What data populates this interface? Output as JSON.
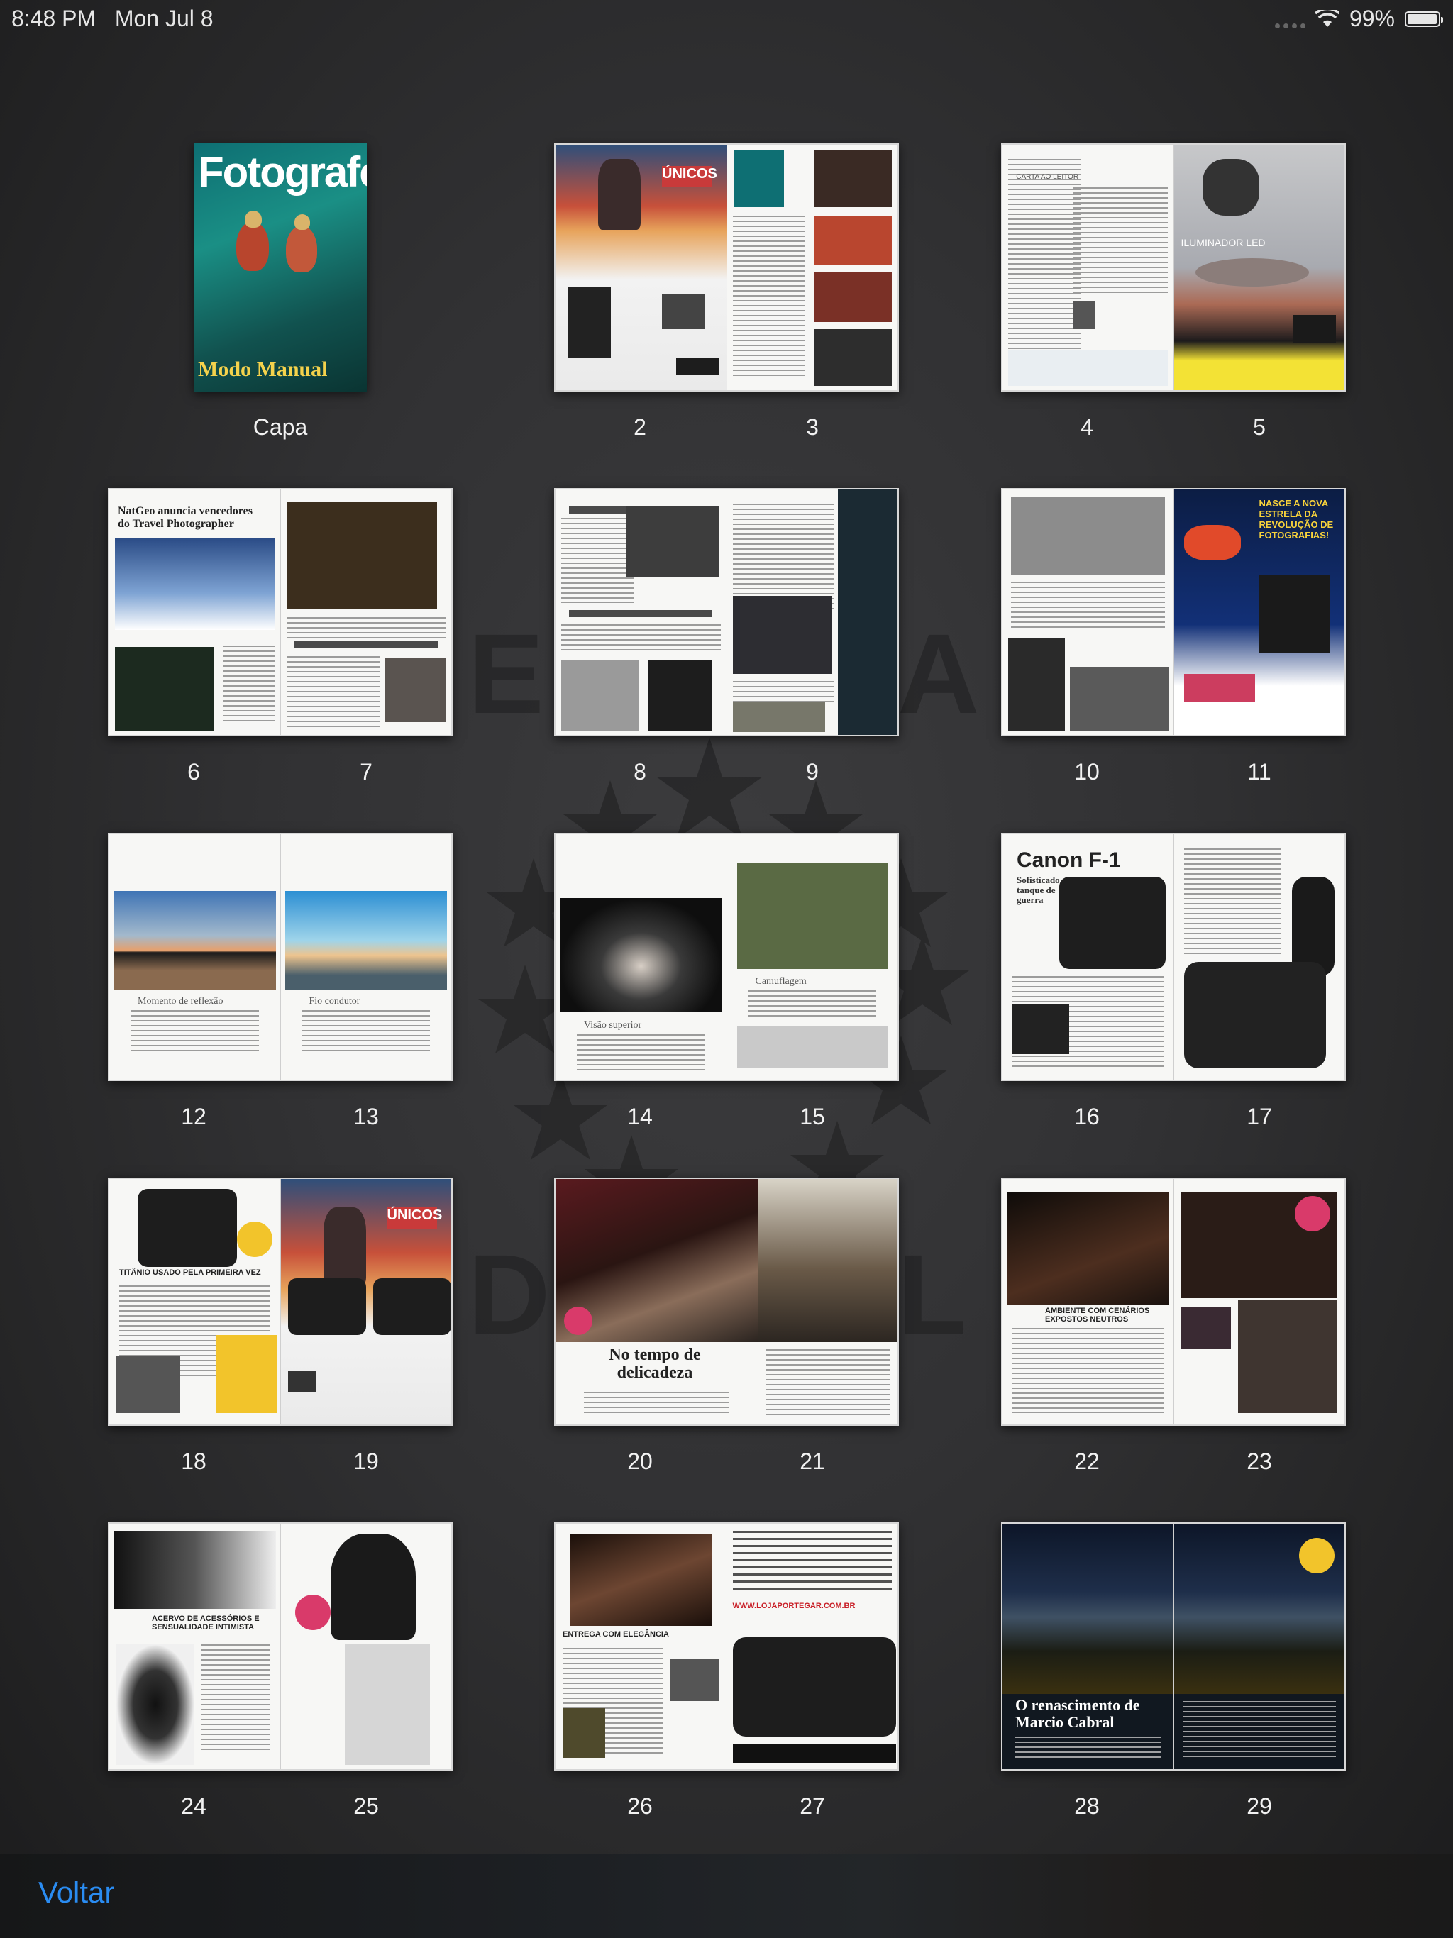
{
  "status_bar": {
    "time": "8:48 PM",
    "date": "Mon Jul 8",
    "wifi_icon": "wifi-icon",
    "battery_percent": "99%",
    "battery_level": 0.99
  },
  "cover": {
    "title": "Fotografe",
    "subtitle": "Modo Manual",
    "label": "Capa"
  },
  "spreads": [
    {
      "left": "2",
      "right": "3",
      "headline_left": "ÚNICOS"
    },
    {
      "left": "4",
      "right": "5",
      "headline_left": "CARTA AO LEITOR",
      "headline_right": "ILUMINADOR LED"
    },
    {
      "left": "6",
      "right": "7",
      "headline_left": "NatGeo anuncia vencedores do Travel Photographer"
    },
    {
      "left": "8",
      "right": "9"
    },
    {
      "left": "10",
      "right": "11",
      "headline_right": "NASCE A NOVA ESTRELA DA REVOLUÇÃO DE FOTOGRAFIAS!"
    },
    {
      "left": "12",
      "right": "13",
      "caption_left": "Momento de reflexão",
      "caption_right": "Fio condutor"
    },
    {
      "left": "14",
      "right": "15",
      "caption_left": "Visão superior",
      "caption_right": "Camuflagem"
    },
    {
      "left": "16",
      "right": "17",
      "headline_left": "Canon F-1",
      "subhead_left": "Sofisticado tanque de guerra"
    },
    {
      "left": "18",
      "right": "19",
      "headline_left": "TITÂNIO USADO PELA PRIMEIRA VEZ",
      "headline_right": "ÚNICOS"
    },
    {
      "left": "20",
      "right": "21",
      "headline_left": "No tempo de delicadeza"
    },
    {
      "left": "22",
      "right": "23",
      "headline_left": "AMBIENTE COM CENÁRIOS EXPOSTOS NEUTROS"
    },
    {
      "left": "24",
      "right": "25",
      "headline_left": "ACERVO DE ACESSÓRIOS E SENSUALIDADE INTIMISTA"
    },
    {
      "left": "26",
      "right": "27",
      "headline_left": "ENTREGA COM ELEGÂNCIA",
      "headline_right": "WWW.LOJAPORTEGAR.COM.BR"
    },
    {
      "left": "28",
      "right": "29",
      "headline_left": "O renascimento de Marcio Cabral"
    }
  ],
  "toolbar": {
    "back_label": "Voltar"
  }
}
